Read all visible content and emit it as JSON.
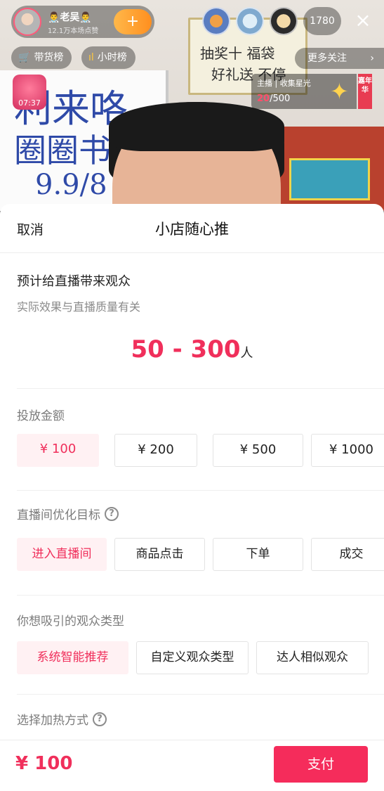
{
  "stream": {
    "host": {
      "name": "👨‍⚕️老吴👨‍⚕️",
      "likes": "12.1万本场点赞",
      "follow_icon": "+"
    },
    "viewer_count": "1780",
    "close_icon": "×",
    "chips": [
      {
        "icon": "cart-icon",
        "glyph": "🛒",
        "label": "带货榜"
      },
      {
        "icon": "bar-chart-icon",
        "glyph": "ıl",
        "label": "小时榜"
      }
    ],
    "more_follow": {
      "label": "更多关注",
      "chevron": "›"
    },
    "timer": "07:37",
    "star_card": {
      "line1": "主播 | 收集星光",
      "current": "20",
      "total": "/500",
      "badge": "嘉年华"
    },
    "sign_text": [
      "抽奖十 福袋",
      "好礼送 不停"
    ],
    "board_text": [
      "利来咯",
      "圈圈书",
      "9.9/8"
    ]
  },
  "sheet": {
    "cancel_label": "取消",
    "title": "小店随心推",
    "estimate": {
      "title": "预计给直播带来观众",
      "subtitle": "实际效果与直播质量有关",
      "range": "50 - 300",
      "unit": "人"
    },
    "amount": {
      "label": "投放金额",
      "options": [
        "¥ 100",
        "¥ 200",
        "¥ 500",
        "¥ 1000"
      ],
      "selected": 0
    },
    "goal": {
      "label": "直播间优化目标",
      "help_icon": "?",
      "options": [
        "进入直播间",
        "商品点击",
        "下单",
        "成交"
      ],
      "selected": 0
    },
    "audience": {
      "label": "你想吸引的观众类型",
      "options": [
        "系统智能推荐",
        "自定义观众类型",
        "达人相似观众"
      ],
      "selected": 0
    },
    "heating": {
      "label": "选择加热方式",
      "help_icon": "?"
    },
    "footer": {
      "total": "¥ 100",
      "pay_label": "支付"
    }
  },
  "colors": {
    "accent": "#f02f5b",
    "selected_bg": "#fff1f3",
    "pay_button": "#f52c5b"
  }
}
